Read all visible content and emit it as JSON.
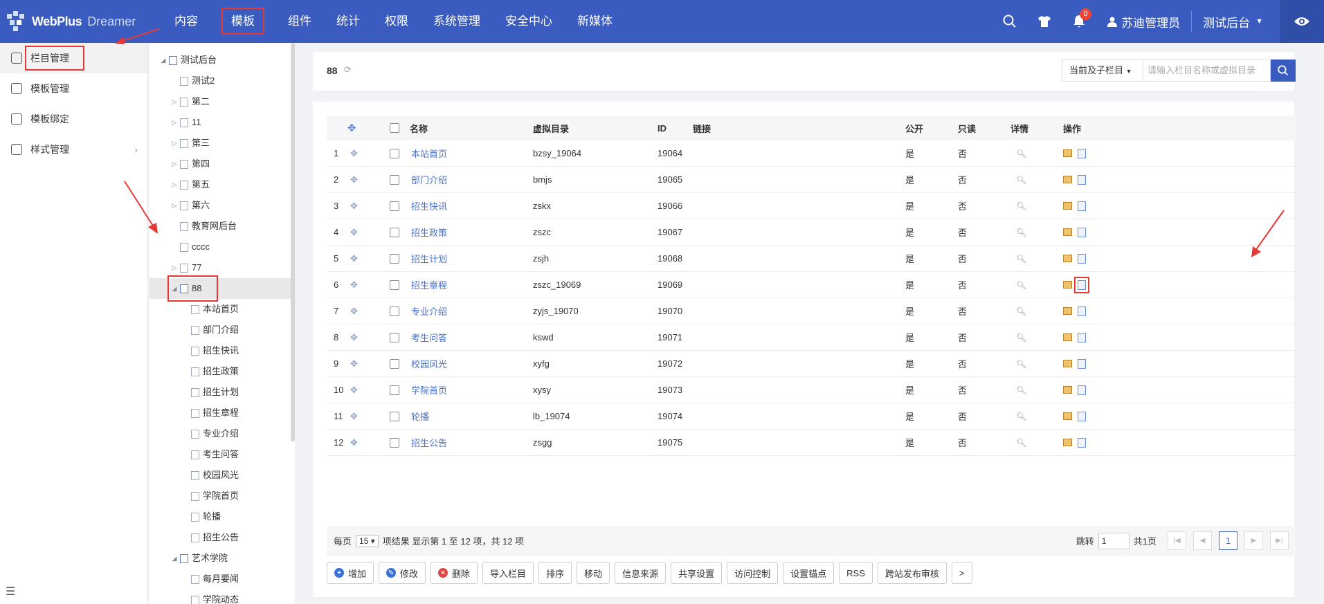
{
  "app": {
    "logo_text": "WebPlus",
    "logo_sub": "Dreamer"
  },
  "nav": [
    {
      "label": "内容"
    },
    {
      "label": "模板"
    },
    {
      "label": "组件"
    },
    {
      "label": "统计"
    },
    {
      "label": "权限"
    },
    {
      "label": "系统管理"
    },
    {
      "label": "安全中心"
    },
    {
      "label": "新媒体"
    }
  ],
  "topright": {
    "notif_count": "0",
    "user": "苏迪管理员",
    "site": "测试后台"
  },
  "sidebar": [
    {
      "label": "栏目管理"
    },
    {
      "label": "模板管理"
    },
    {
      "label": "模板绑定"
    },
    {
      "label": "样式管理"
    }
  ],
  "tree": [
    {
      "label": "测试后台",
      "level": 0,
      "toggle": "◢",
      "site": true
    },
    {
      "label": "测试2",
      "level": 1,
      "toggle": ""
    },
    {
      "label": "第二",
      "level": 1,
      "toggle": "▷"
    },
    {
      "label": "11",
      "level": 1,
      "toggle": "▷"
    },
    {
      "label": "第三",
      "level": 1,
      "toggle": "▷"
    },
    {
      "label": "第四",
      "level": 1,
      "toggle": "▷"
    },
    {
      "label": "第五",
      "level": 1,
      "toggle": "▷"
    },
    {
      "label": "第六",
      "level": 1,
      "toggle": "▷"
    },
    {
      "label": "教育网后台",
      "level": 1,
      "toggle": ""
    },
    {
      "label": "cccc",
      "level": 1,
      "toggle": ""
    },
    {
      "label": "77",
      "level": 1,
      "toggle": "▷"
    },
    {
      "label": "88",
      "level": 1,
      "toggle": "◢",
      "site": true,
      "selected": true
    },
    {
      "label": "本站首页",
      "level": 2,
      "toggle": ""
    },
    {
      "label": "部门介绍",
      "level": 2,
      "toggle": ""
    },
    {
      "label": "招生快讯",
      "level": 2,
      "toggle": ""
    },
    {
      "label": "招生政策",
      "level": 2,
      "toggle": ""
    },
    {
      "label": "招生计划",
      "level": 2,
      "toggle": ""
    },
    {
      "label": "招生章程",
      "level": 2,
      "toggle": ""
    },
    {
      "label": "专业介绍",
      "level": 2,
      "toggle": ""
    },
    {
      "label": "考生问答",
      "level": 2,
      "toggle": ""
    },
    {
      "label": "校园风光",
      "level": 2,
      "toggle": ""
    },
    {
      "label": "学院首页",
      "level": 2,
      "toggle": ""
    },
    {
      "label": "轮播",
      "level": 2,
      "toggle": ""
    },
    {
      "label": "招生公告",
      "level": 2,
      "toggle": ""
    },
    {
      "label": "艺术学院",
      "level": 1,
      "toggle": "◢",
      "site": true
    },
    {
      "label": "每月要闻",
      "level": 2,
      "toggle": ""
    },
    {
      "label": "学院动态",
      "level": 2,
      "toggle": ""
    }
  ],
  "header": {
    "title": "88",
    "scope": "当前及子栏目",
    "search_placeholder": "请输入栏目名称或虚拟目录"
  },
  "table": {
    "columns": {
      "name": "名称",
      "vdir": "虚拟目录",
      "id": "ID",
      "link": "链接",
      "public": "公开",
      "readonly": "只读",
      "detail": "详情",
      "ops": "操作"
    },
    "rows": [
      {
        "no": "1",
        "name": "本站首页",
        "vdir": "bzsy_19064",
        "id": "19064",
        "public": "是",
        "readonly": "否"
      },
      {
        "no": "2",
        "name": "部门介绍",
        "vdir": "bmjs",
        "id": "19065",
        "public": "是",
        "readonly": "否"
      },
      {
        "no": "3",
        "name": "招生快讯",
        "vdir": "zskx",
        "id": "19066",
        "public": "是",
        "readonly": "否"
      },
      {
        "no": "4",
        "name": "招生政策",
        "vdir": "zszc",
        "id": "19067",
        "public": "是",
        "readonly": "否"
      },
      {
        "no": "5",
        "name": "招生计划",
        "vdir": "zsjh",
        "id": "19068",
        "public": "是",
        "readonly": "否"
      },
      {
        "no": "6",
        "name": "招生章程",
        "vdir": "zszc_19069",
        "id": "19069",
        "public": "是",
        "readonly": "否"
      },
      {
        "no": "7",
        "name": "专业介绍",
        "vdir": "zyjs_19070",
        "id": "19070",
        "public": "是",
        "readonly": "否"
      },
      {
        "no": "8",
        "name": "考生问答",
        "vdir": "kswd",
        "id": "19071",
        "public": "是",
        "readonly": "否"
      },
      {
        "no": "9",
        "name": "校园风光",
        "vdir": "xyfg",
        "id": "19072",
        "public": "是",
        "readonly": "否"
      },
      {
        "no": "10",
        "name": "学院首页",
        "vdir": "xysy",
        "id": "19073",
        "public": "是",
        "readonly": "否"
      },
      {
        "no": "11",
        "name": "轮播",
        "vdir": "lb_19074",
        "id": "19074",
        "public": "是",
        "readonly": "否"
      },
      {
        "no": "12",
        "name": "招生公告",
        "vdir": "zsgg",
        "id": "19075",
        "public": "是",
        "readonly": "否"
      }
    ]
  },
  "pager": {
    "per_page_label": "每页",
    "per_page": "15",
    "summary": "项结果 显示第 1 至 12 项，共 12 项",
    "jump_label": "跳转",
    "jump_value": "1",
    "total_pages": "共1页",
    "current": "1"
  },
  "buttons": [
    {
      "label": "增加",
      "icon": "plus-icon",
      "color": "#3a72d8"
    },
    {
      "label": "修改",
      "icon": "edit-icon",
      "color": "#3a72d8"
    },
    {
      "label": "删除",
      "icon": "delete-icon",
      "color": "#e04848"
    },
    {
      "label": "导入栏目"
    },
    {
      "label": "排序"
    },
    {
      "label": "移动"
    },
    {
      "label": "信息来源"
    },
    {
      "label": "共享设置"
    },
    {
      "label": "访问控制"
    },
    {
      "label": "设置锚点"
    },
    {
      "label": "RSS"
    },
    {
      "label": "跨站发布审核"
    },
    {
      "label": ">"
    }
  ],
  "colors": {
    "primary": "#3a5cc0",
    "highlight": "#e53935",
    "link": "#4a6fc9"
  }
}
